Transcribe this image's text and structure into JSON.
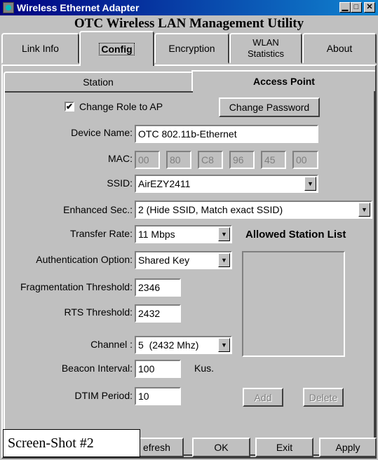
{
  "window": {
    "title": "Wireless Ethernet Adapter",
    "subtitle": "OTC Wireless LAN Management Utility",
    "minimize": "▁",
    "maximize": "□",
    "close": "✕"
  },
  "tabs": [
    {
      "label": "Link Info"
    },
    {
      "label": "Config"
    },
    {
      "label": "Encryption"
    },
    {
      "label": "WLAN\nStatistics"
    },
    {
      "label": "About"
    }
  ],
  "subtabs": {
    "station": "Station",
    "access_point": "Access Point"
  },
  "form": {
    "change_role": {
      "label": "Change Role to AP",
      "checked": true
    },
    "change_password": "Change Password",
    "device_name": {
      "label": "Device Name:",
      "value": "OTC 802.11b-Ethernet"
    },
    "mac": {
      "label": "MAC:",
      "values": [
        "00",
        "80",
        "C8",
        "96",
        "45",
        "00"
      ]
    },
    "ssid": {
      "label": "SSID:",
      "value": "AirEZY2411"
    },
    "enhanced_sec": {
      "label": "Enhanced Sec.:",
      "value": "2 (Hide SSID, Match exact SSID)"
    },
    "transfer_rate": {
      "label": "Transfer Rate:",
      "value": "11 Mbps"
    },
    "auth_option": {
      "label": "Authentication Option:",
      "value": "Shared Key"
    },
    "frag_threshold": {
      "label": "Fragmentation Threshold:",
      "value": "2346"
    },
    "rts_threshold": {
      "label": "RTS Threshold:",
      "value": "2432"
    },
    "channel": {
      "label": "Channel :",
      "value": "5  (2432 Mhz)"
    },
    "beacon_interval": {
      "label": "Beacon Interval:",
      "value": "100",
      "unit": "Kus."
    },
    "dtim_period": {
      "label": "DTIM Period:",
      "value": "10"
    }
  },
  "allowed_list": {
    "title": "Allowed Station List",
    "add": "Add",
    "delete": "Delete"
  },
  "footer": {
    "refresh": "efresh",
    "ok": "OK",
    "exit": "Exit",
    "apply": "Apply"
  },
  "caption": "Screen-Shot #2",
  "icons": {
    "dropdown": "▼",
    "check": "✔"
  }
}
